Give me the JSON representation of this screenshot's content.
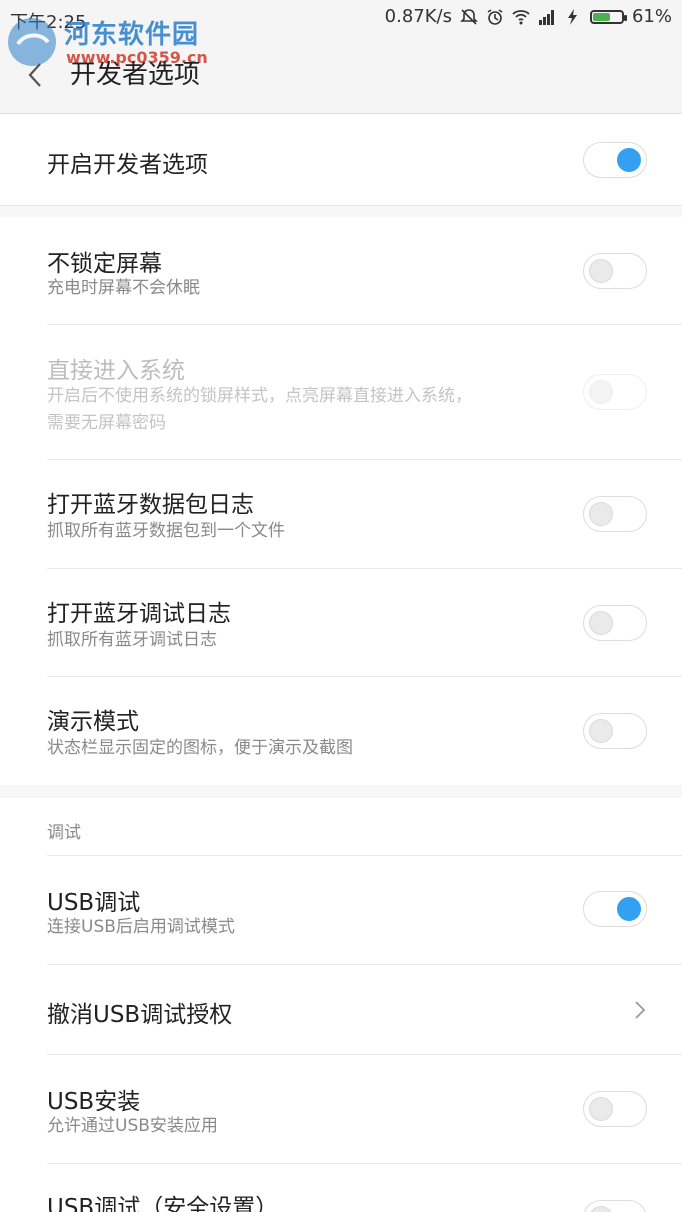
{
  "status_bar": {
    "time": "下午2:25",
    "speed": "0.87K/s",
    "battery": "61%",
    "battery_level": 0.61,
    "icons": [
      "mute-icon",
      "alarm-icon",
      "wifi-icon",
      "signal-icon",
      "charging-icon",
      "battery-icon"
    ]
  },
  "watermark": {
    "name": "河东软件园",
    "url": "www.pc0359.cn"
  },
  "header": {
    "title": "开发者选项"
  },
  "main_toggle": {
    "label": "开启开发者选项",
    "on": true
  },
  "items": [
    {
      "label": "不锁定屏幕",
      "sub": "充电时屏幕不会休眠",
      "on": false
    },
    {
      "label": "直接进入系统",
      "sub1": "开启后不使用系统的锁屏样式，点亮屏幕直接进入系统，",
      "sub2": "需要无屏幕密码",
      "on": false,
      "enabled": false
    },
    {
      "label": "打开蓝牙数据包日志",
      "sub": "抓取所有蓝牙数据包到一个文件",
      "on": false
    },
    {
      "label": "打开蓝牙调试日志",
      "sub": "抓取所有蓝牙调试日志",
      "on": false
    },
    {
      "label": "演示模式",
      "sub": "状态栏显示固定的图标，便于演示及截图",
      "on": false
    }
  ],
  "debug": {
    "category": "调试",
    "items": [
      {
        "label": "USB调试",
        "sub": "连接USB后启用调试模式",
        "on": true
      },
      {
        "label": "撤消USB调试授权"
      },
      {
        "label": "USB安装",
        "sub": "允许通过USB安装应用",
        "on": false
      },
      {
        "label": "USB调试（安全设置）",
        "on": false
      }
    ]
  },
  "colors": {
    "accent": "#33a0f2",
    "battery": "#4caf50"
  }
}
